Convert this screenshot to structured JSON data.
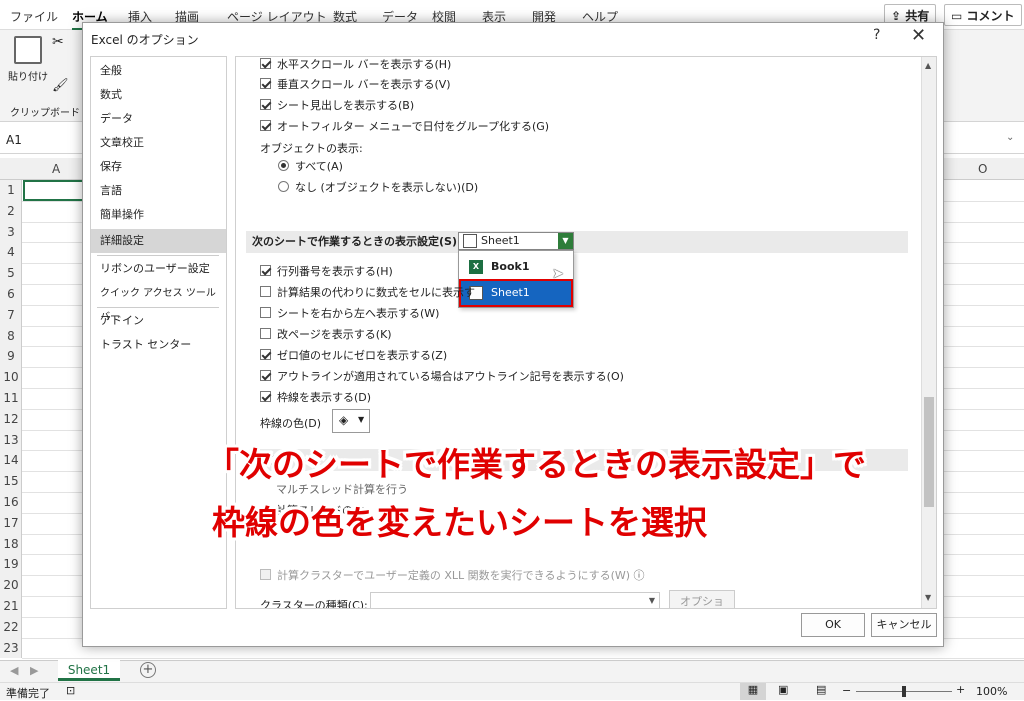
{
  "menu": [
    "ファイル",
    "ホーム",
    "挿入",
    "描画",
    "ページ レイアウト",
    "数式",
    "データ",
    "校閲",
    "表示",
    "開発",
    "ヘルプ"
  ],
  "share_label": "共有",
  "comment_label": "コメント",
  "ribbon": {
    "paste_label": "貼り付け",
    "clipboard_label": "クリップボード"
  },
  "namebox": "A1",
  "columns": [
    "A",
    "O"
  ],
  "rows": [
    "1",
    "2",
    "3",
    "4",
    "5",
    "6",
    "7",
    "8",
    "9",
    "10",
    "11",
    "12",
    "13",
    "14",
    "15",
    "16",
    "17",
    "18",
    "19",
    "20",
    "21",
    "22",
    "23"
  ],
  "sheet_tab": "Sheet1",
  "status": {
    "ready": "準備完了",
    "zoom": "100%"
  },
  "dialog": {
    "title": "Excel のオプション",
    "help": "?",
    "close": "✕",
    "nav": [
      "全般",
      "数式",
      "データ",
      "文章校正",
      "保存",
      "言語",
      "簡単操作",
      "詳細設定",
      "リボンのユーザー設定",
      "クイック アクセス ツール バー",
      "アドイン",
      "トラスト センター"
    ],
    "selected_nav": "詳細設定",
    "options_top": [
      {
        "label": "水平スクロール バーを表示する(H)",
        "checked": true
      },
      {
        "label": "垂直スクロール バーを表示する(V)",
        "checked": true
      },
      {
        "label": "シート見出しを表示する(B)",
        "checked": true
      },
      {
        "label": "オートフィルター メニューで日付をグループ化する(G)",
        "checked": true
      }
    ],
    "objects_label": "オブジェクトの表示:",
    "radio_all": "すべて(A)",
    "radio_none": "なし (オブジェクトを表示しない)(D)",
    "sheet_section_label": "次のシートで作業するときの表示設定(S):",
    "sheet_select_value": "Sheet1",
    "dropdown_items": [
      "Book1",
      "Sheet1"
    ],
    "options_sheet": [
      {
        "label": "行列番号を表示する(H)",
        "checked": true
      },
      {
        "label": "計算結果の代わりに数式をセルに表示す",
        "checked": false
      },
      {
        "label": "シートを右から左へ表示する(W)",
        "checked": false
      },
      {
        "label": "改ページを表示する(K)",
        "checked": false
      },
      {
        "label": "ゼロ値のセルにゼロを表示する(Z)",
        "checked": true
      },
      {
        "label": "アウトラインが適用されている場合はアウトライン記号を表示する(O)",
        "checked": true
      },
      {
        "label": "枠線を表示する(D)",
        "checked": true
      }
    ],
    "gridline_color_label": "枠線の色(D)",
    "formula_section": "数式",
    "calc_multithread_partial": "マルチスレッド計算を行う",
    "calc_threads_label": "計算スレッドの数",
    "cluster_udf_label": "計算クラスターでユーザー定義の XLL 関数を実行できるようにする(W)",
    "cluster_type_label": "クラスターの種類(C):",
    "options_button": "オプション...",
    "ok": "OK",
    "cancel": "キャンセル"
  },
  "annotation": {
    "line1": "「次のシートで作業するときの表示設定」で",
    "line2": "枠線の色を変えたいシートを選択"
  },
  "colors": {
    "excel_green": "#217346",
    "highlight_blue": "#1565c0",
    "annotation_red": "#e00000"
  }
}
